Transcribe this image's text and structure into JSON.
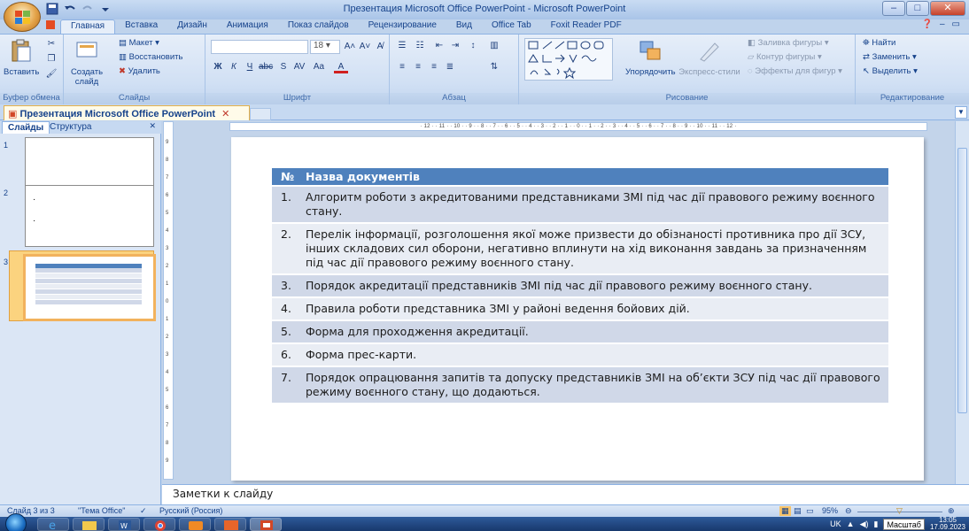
{
  "window": {
    "title": "Презентация Microsoft Office PowerPoint - Microsoft PowerPoint",
    "minimize": "–",
    "maximize": "□",
    "close": "✕"
  },
  "ribbon_tabs": [
    "Главная",
    "Вставка",
    "Дизайн",
    "Анимация",
    "Показ слайдов",
    "Рецензирование",
    "Вид",
    "Office Tab",
    "Foxit Reader PDF"
  ],
  "ribbon": {
    "clipboard": {
      "paste": "Вставить",
      "label": "Буфер обмена"
    },
    "slides": {
      "create": "Создать слайд",
      "layout": "Макет",
      "reset": "Восстановить",
      "delete": "Удалить",
      "label": "Слайды"
    },
    "font": {
      "size": "18",
      "label": "Шрифт"
    },
    "paragraph": {
      "label": "Абзац"
    },
    "drawing": {
      "arrange": "Упорядочить",
      "quick_styles": "Экспресс-стили",
      "fill": "Заливка фигуры",
      "outline": "Контур фигуры",
      "effects": "Эффекты для фигур",
      "label": "Рисование"
    },
    "editing": {
      "find": "Найти",
      "replace": "Заменить",
      "select": "Выделить",
      "label": "Редактирование"
    }
  },
  "doc_tab": {
    "title": "Презентация Microsoft Office PowerPoint",
    "close": "✕"
  },
  "panel": {
    "tab_slides": "Слайды",
    "tab_outline": "Структура",
    "close": "✕",
    "slides": [
      "1",
      "2",
      "3"
    ]
  },
  "ruler": {
    "horizontal": "· 12 · · 11 · · 10 · · 9 · · 8 · · 7 · · 6 · · 5 · · 4 · · 3 · · 2 · · 1 · · 0 · · 1 · · 2 · · 3 · · 4 · · 5 · · 6 · · 7 · · 8 · · 9 · · 10 · · 11 · · 12 ·",
    "vertical": [
      "9",
      "8",
      "7",
      "6",
      "5",
      "4",
      "3",
      "2",
      "1",
      "0",
      "1",
      "2",
      "3",
      "4",
      "5",
      "6",
      "7",
      "8",
      "9"
    ]
  },
  "slide_table": {
    "headers": [
      "№",
      "Назва документів"
    ],
    "rows": [
      {
        "num": "1.",
        "text": "Алгоритм роботи з акредитованими представниками ЗМІ під час дії правового режиму воєнного стану."
      },
      {
        "num": "2.",
        "text": "Перелік інформації, розголошення якої може призвести до обізнаності противника про дії ЗСУ, інших складових сил оборони, негативно вплинути на хід виконання завдань за призначенням під час дії правового режиму воєнного стану."
      },
      {
        "num": "3.",
        "text": "Порядок акредитації представників ЗМІ під час дії правового режиму воєнного стану."
      },
      {
        "num": "4.",
        "text": "Правила роботи представника ЗМІ у районі ведення бойових дій."
      },
      {
        "num": "5.",
        "text": "Форма для проходження акредитації."
      },
      {
        "num": "6.",
        "text": "Форма прес-карти."
      },
      {
        "num": "7.",
        "text": "Порядок опрацювання запитів та допуску представників ЗМІ на об’єкти ЗСУ під час дії правового режиму воєнного стану, що додаються."
      }
    ]
  },
  "notes": {
    "placeholder": "Заметки к слайду"
  },
  "status": {
    "slide_info": "Слайд 3 из 3",
    "theme": "\"Тема Office\"",
    "language": "Русский (Россия)",
    "zoom": "95%"
  },
  "taskbar": {
    "lang": "UK",
    "tooltip": "Масштаб",
    "time": "13:05",
    "date": "17.09.2023"
  },
  "colors": {
    "header_blue": "#4f81bd",
    "row_dark": "#d0d8e8",
    "row_light": "#e9edf4",
    "selection": "#f2b25d"
  }
}
